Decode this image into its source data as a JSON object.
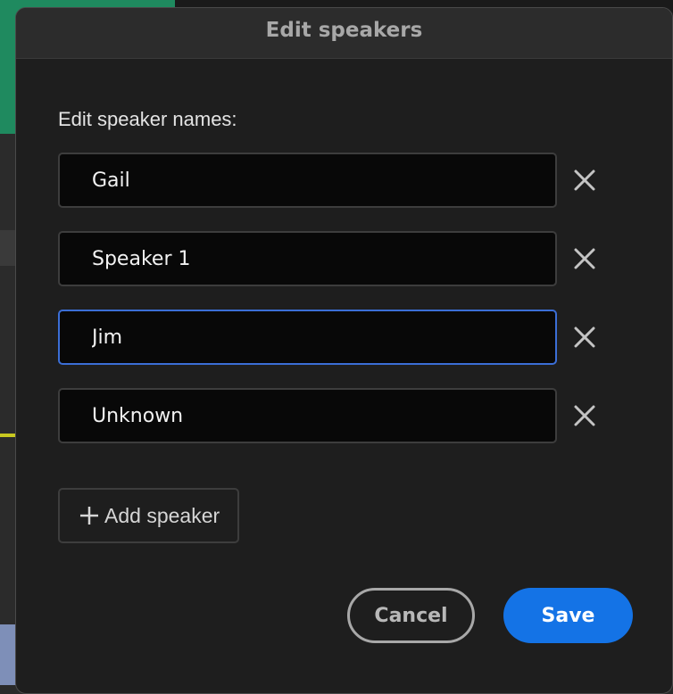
{
  "dialog": {
    "title": "Edit speakers",
    "section_label": "Edit speaker names:",
    "speakers": [
      {
        "value": "Gail",
        "focused": false
      },
      {
        "value": "Speaker 1",
        "focused": false
      },
      {
        "value": "Jim",
        "focused": true
      },
      {
        "value": "Unknown",
        "focused": false
      }
    ],
    "remove_icon": "close-icon",
    "add_speaker_label": "Add speaker",
    "add_icon": "plus-icon",
    "cancel_label": "Cancel",
    "save_label": "Save"
  },
  "colors": {
    "accent": "#1473e6",
    "focus_border": "#3b6ed6",
    "dialog_bg": "#1e1e1e",
    "input_bg": "#080808"
  }
}
